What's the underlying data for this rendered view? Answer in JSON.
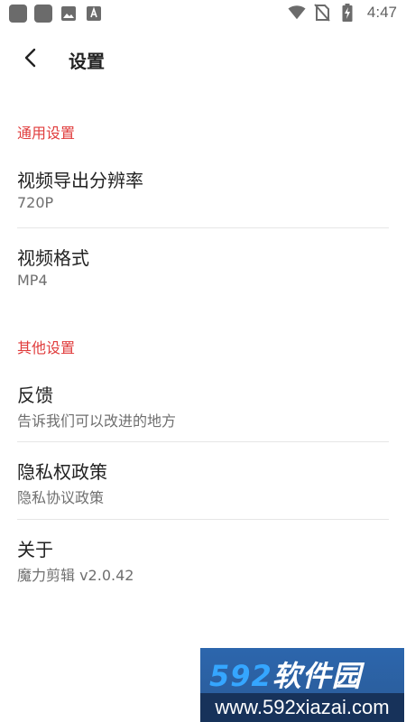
{
  "status_bar": {
    "time": "4:47"
  },
  "app_bar": {
    "title": "设置"
  },
  "sections": [
    {
      "header": "通用设置",
      "items": [
        {
          "title": "视频导出分辨率",
          "summary": "720P"
        },
        {
          "title": "视频格式",
          "summary": "MP4"
        }
      ]
    },
    {
      "header": "其他设置",
      "items": [
        {
          "title": "反馈",
          "summary": "告诉我们可以改进的地方"
        },
        {
          "title": "隐私权政策",
          "summary": "隐私协议政策"
        },
        {
          "title": "关于",
          "summary": "魔力剪辑 v2.0.42"
        }
      ]
    }
  ],
  "watermark": {
    "logo_number": "592",
    "logo_text": "软件园",
    "url": "www.592xiazai.com"
  },
  "colors": {
    "accent": "#e03c3c",
    "title_text": "#222222",
    "summary_text": "#6f6f6f",
    "divider": "#e6e6e6"
  },
  "icons": [
    "app-notification-icon",
    "image-icon",
    "text-icon",
    "wifi-icon",
    "no-sim-icon",
    "battery-charging-icon",
    "back-arrow-icon"
  ]
}
